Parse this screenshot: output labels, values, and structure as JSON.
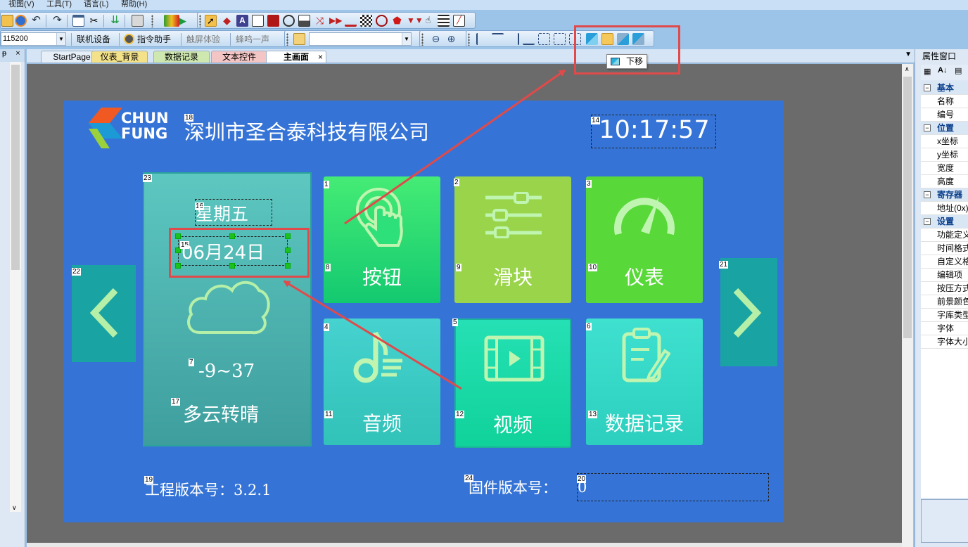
{
  "menu": [
    "视图(V)",
    "工具(T)",
    "语言(L)",
    "帮助(H)"
  ],
  "toolbar2": {
    "baud": "115200",
    "connect": "联机设备",
    "cmd_helper": "指令助手",
    "touch_exp": "触屏体验",
    "buzzer": "蜂鸣一声"
  },
  "tooltip": "下移",
  "left_panel_pin": "ᵽ",
  "left_panel_close": "×",
  "tabs": [
    {
      "label": "StartPage"
    },
    {
      "label": "仪表_背景"
    },
    {
      "label": "数据记录"
    },
    {
      "label": "文本控件"
    },
    {
      "label": "主画面"
    }
  ],
  "tab_close": "×",
  "screen": {
    "logo_line1": "CHUN",
    "logo_line2": "FUNG",
    "company": "深圳市圣合泰科技有限公司",
    "clock": "10:17:57",
    "weekday": "星期五",
    "date": "06月24日",
    "temperature": "-9~37",
    "weather": "多云转晴",
    "project_version": "工程版本号：3.2.1",
    "firmware_label": "固件版本号：",
    "firmware_value": "0",
    "tiles": [
      {
        "label": "按钮",
        "icon": "touch-icon"
      },
      {
        "label": "滑块",
        "icon": "sliders-icon"
      },
      {
        "label": "仪表",
        "icon": "gauge-icon"
      },
      {
        "label": "音频",
        "icon": "music-icon"
      },
      {
        "label": "视频",
        "icon": "film-icon"
      },
      {
        "label": "数据记录",
        "icon": "clipboard-icon"
      }
    ],
    "ids": [
      "1",
      "2",
      "3",
      "4",
      "5",
      "6",
      "7",
      "8",
      "9",
      "10",
      "11",
      "12",
      "13",
      "14",
      "15",
      "16",
      "17",
      "18",
      "19",
      "20",
      "21",
      "22",
      "23",
      "24"
    ]
  },
  "properties": {
    "title": "属性窗口",
    "groups": [
      {
        "name": "基本",
        "items": [
          "名称",
          "编号"
        ]
      },
      {
        "name": "位置",
        "items": [
          "x坐标",
          "y坐标",
          "宽度",
          "高度"
        ]
      },
      {
        "name": "寄存器",
        "items": [
          "地址(0x)"
        ]
      },
      {
        "name": "设置",
        "items": [
          "功能定义",
          "时间格式",
          "自定义格",
          "编辑项",
          "按压方式",
          "前景颜色",
          "字库类型",
          "字体",
          "字体大小"
        ]
      }
    ],
    "toggle": "−"
  },
  "colors": {
    "screen_bg": "#3574d6",
    "canvas_bg": "#6b6b6b",
    "tile_green_bright": "#2ee07a",
    "tile_lime": "#9ad44a",
    "tile_green": "#59d83a",
    "tile_teal": "#3dcfc0",
    "annotation": "#e04a4a"
  }
}
